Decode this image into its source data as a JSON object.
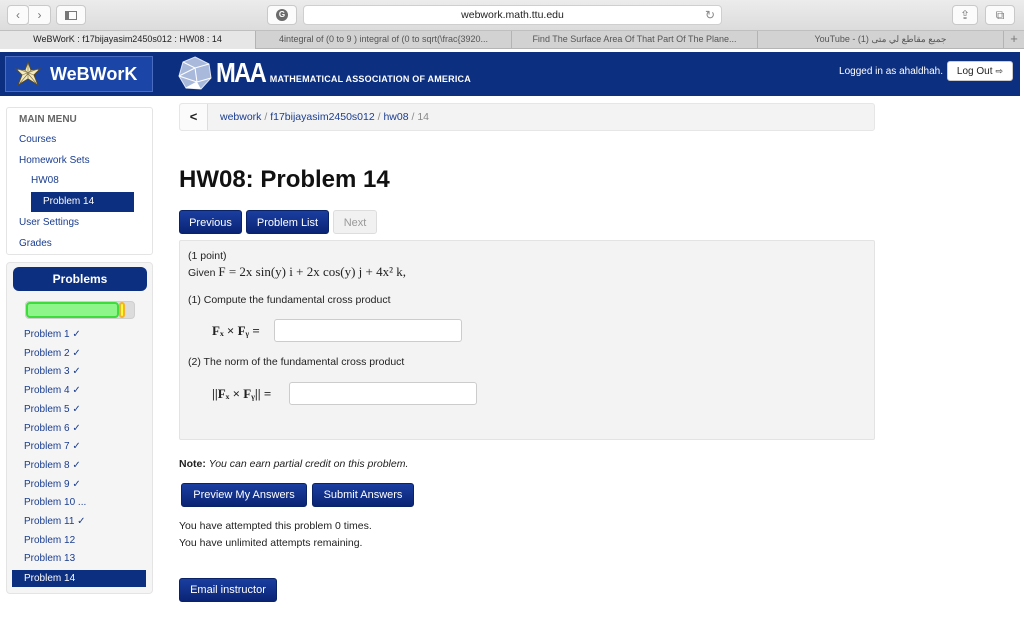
{
  "browser": {
    "url": "webwork.math.ttu.edu",
    "tabs": [
      {
        "label": "WeBWorK : f17bijayasim2450s012 : HW08 : 14",
        "active": true
      },
      {
        "label": "4integral of (0 to 9 ) integral of (0 to sqrt(\\frac{3920...",
        "active": false
      },
      {
        "label": "Find The Surface Area Of That Part Of The Plane...",
        "active": false
      },
      {
        "label": "YouTube - جميع مقاطع لي متى (1)",
        "active": false
      }
    ],
    "new_tab_label": "+"
  },
  "header": {
    "app_name": "WeBWorK",
    "maa_name": "MAA",
    "maa_subtitle": "MATHEMATICAL ASSOCIATION OF AMERICA",
    "logged_in_text": "Logged in as ahaldhah.",
    "logout_label": "Log Out",
    "brand_color": "#0d2f80"
  },
  "main_menu": {
    "heading": "MAIN MENU",
    "items": [
      {
        "label": "Courses"
      },
      {
        "label": "Homework Sets"
      },
      {
        "label": "HW08"
      },
      {
        "label": "Problem 14",
        "active": true
      },
      {
        "label": "User Settings"
      },
      {
        "label": "Grades"
      }
    ]
  },
  "problems_panel": {
    "heading": "Problems",
    "progress": {
      "correct_fraction": 0.857,
      "partial_fraction": 0.036
    },
    "items": [
      {
        "label": "Problem 1 ✓"
      },
      {
        "label": "Problem 2 ✓"
      },
      {
        "label": "Problem 3 ✓"
      },
      {
        "label": "Problem 4 ✓"
      },
      {
        "label": "Problem 5 ✓"
      },
      {
        "label": "Problem 6 ✓"
      },
      {
        "label": "Problem 7 ✓"
      },
      {
        "label": "Problem 8 ✓"
      },
      {
        "label": "Problem 9 ✓"
      },
      {
        "label": "Problem 10 ..."
      },
      {
        "label": "Problem 11 ✓"
      },
      {
        "label": "Problem 12"
      },
      {
        "label": "Problem 13"
      },
      {
        "label": "Problem 14",
        "active": true
      }
    ]
  },
  "breadcrumb": {
    "back_label": "<",
    "parts": [
      "webwork",
      "f17bijayasim2450s012",
      "hw08"
    ],
    "current": "14",
    "separator": " / "
  },
  "page": {
    "title": "HW08: Problem 14",
    "nav": {
      "previous": "Previous",
      "problem_list": "Problem List",
      "next": "Next"
    }
  },
  "problem": {
    "points": "(1 point)",
    "given_prefix": "Given ",
    "given_formula": "F = 2x sin(y) i + 2x cos(y) j + 4x² k,",
    "part1_text": "(1) Compute the fundamental cross product",
    "part1_label": "Fₓ × Fᵧ =",
    "part1_value": "",
    "part2_text": "(2) The norm of the fundamental cross product",
    "part2_label": "||Fₓ × Fᵧ|| =",
    "part2_value": ""
  },
  "note": {
    "label": "Note:",
    "text": "You can earn partial credit on this problem."
  },
  "actions": {
    "preview": "Preview My Answers",
    "submit": "Submit Answers",
    "email": "Email instructor"
  },
  "attempts": {
    "line1": "You have attempted this problem 0 times.",
    "line2": "You have unlimited attempts remaining."
  }
}
